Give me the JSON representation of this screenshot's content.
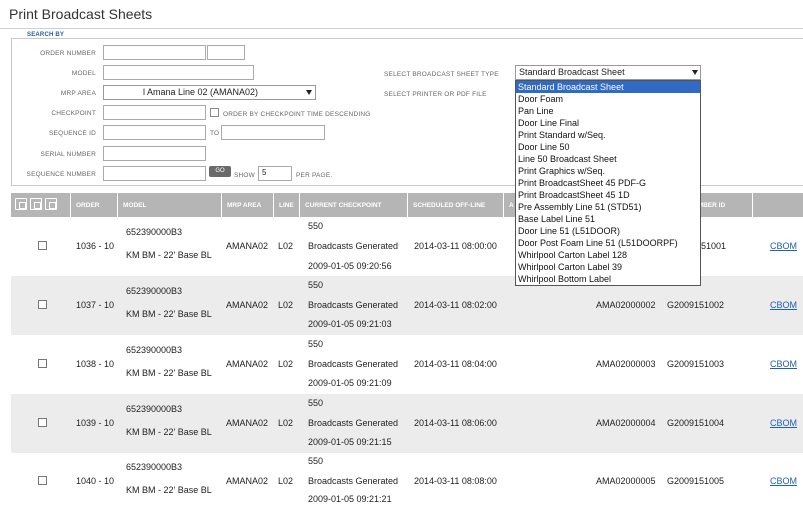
{
  "page": {
    "title": "Print Broadcast Sheets"
  },
  "search": {
    "legend": "SEARCH BY",
    "labels": {
      "order_number": "ORDER NUMBER",
      "model": "MODEL",
      "mrp_area": "MRP AREA",
      "checkpoint": "CHECKPOINT",
      "order_by_checkpoint": "ORDER BY CHECKPOINT TIME DESCENDING",
      "sequence_id": "SEQUENCE ID",
      "to": "TO",
      "serial_number": "SERIAL NUMBER",
      "sequence_number": "SEQUENCE NUMBER",
      "show": "SHOW",
      "per_page": "PER PAGE.",
      "broadcast_sheet_type": "SELECT BROADCAST SHEET TYPE",
      "printer_or_pdf": "SELECT PRINTER OR PDF FILE"
    },
    "mrp_area_value": "l Amana Line 02 (AMANA02)",
    "show_value": "5",
    "go_label": "GO",
    "broadcast_sheet_value": "Standard Broadcast Sheet"
  },
  "dropdown": {
    "options": [
      "Standard Broadcast Sheet",
      "Door Foam",
      "Pan Line",
      "Door Line Final",
      "Print Standard w/Seq.",
      "Door Line 50",
      "Line 50 Broadcast Sheet",
      "Print Graphics w/Seq.",
      "Print BroadcastSheet 45 PDF-G",
      "Print BroadcastSheet 45 1D",
      "Pre Assembly Line 51 (STD51)",
      "Base Label Line 51",
      "Door Line 51 (L51DOOR)",
      "Door Post Foam Line 51 (L51DOORPF)",
      "Whirlpool Carton Label 128",
      "Whirlpool Carton Label 39",
      "Whirlpool Bottom Label"
    ],
    "selected_index": 0
  },
  "table": {
    "headers": {
      "order": "ORDER",
      "model": "MODEL",
      "mrp_area": "MRP AREA",
      "line": "LINE",
      "current_checkpoint": "CURRENT CHECKPOINT",
      "scheduled_off_line": "SCHEDULED OFF-LINE",
      "a": "A",
      "number_id": "UMBER ID"
    },
    "rows": [
      {
        "order": "1036 - 10",
        "model_num": "652390000B3",
        "model_desc": "KM BM - 22' Base BL",
        "mrp": "AMANA02",
        "line": "L02",
        "cp_code": "550",
        "cp_status": "Broadcasts Generated",
        "cp_time": "2009-01-05 09:20:56",
        "scheduled": "2014-03-11 08:00:00",
        "seq": "",
        "serial": "51001",
        "link": "CBOM"
      },
      {
        "order": "1037 - 10",
        "model_num": "652390000B3",
        "model_desc": "KM BM - 22' Base BL",
        "mrp": "AMANA02",
        "line": "L02",
        "cp_code": "550",
        "cp_status": "Broadcasts Generated",
        "cp_time": "2009-01-05 09:21:03",
        "scheduled": "2014-03-11 08:02:00",
        "seq": "AMA02000002",
        "serial": "G2009151002",
        "link": "CBOM"
      },
      {
        "order": "1038 - 10",
        "model_num": "652390000B3",
        "model_desc": "KM BM - 22' Base BL",
        "mrp": "AMANA02",
        "line": "L02",
        "cp_code": "550",
        "cp_status": "Broadcasts Generated",
        "cp_time": "2009-01-05 09:21:09",
        "scheduled": "2014-03-11 08:04:00",
        "seq": "AMA02000003",
        "serial": "G2009151003",
        "link": "CBOM"
      },
      {
        "order": "1039 - 10",
        "model_num": "652390000B3",
        "model_desc": "KM BM - 22' Base BL",
        "mrp": "AMANA02",
        "line": "L02",
        "cp_code": "550",
        "cp_status": "Broadcasts Generated",
        "cp_time": "2009-01-05 09:21:15",
        "scheduled": "2014-03-11 08:06:00",
        "seq": "AMA02000004",
        "serial": "G2009151004",
        "link": "CBOM"
      },
      {
        "order": "1040 - 10",
        "model_num": "652390000B3",
        "model_desc": "KM BM - 22' Base BL",
        "mrp": "AMANA02",
        "line": "L02",
        "cp_code": "550",
        "cp_status": "Broadcasts Generated",
        "cp_time": "2009-01-05 09:21:21",
        "scheduled": "2014-03-11 08:08:00",
        "seq": "AMA02000005",
        "serial": "G2009151005",
        "link": "CBOM"
      }
    ]
  }
}
